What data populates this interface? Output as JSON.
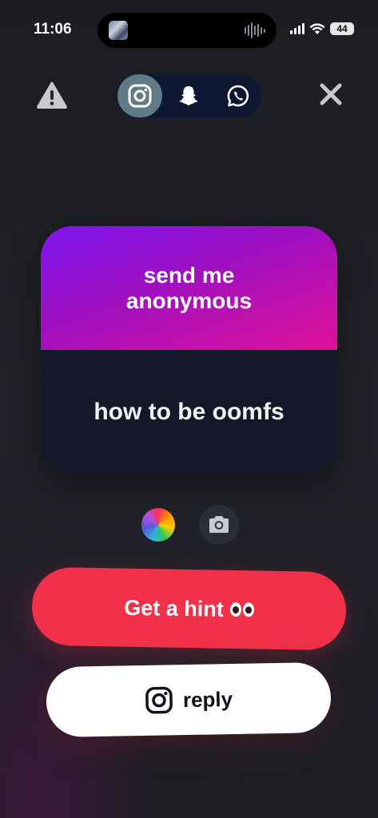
{
  "status_bar": {
    "time": "11:06",
    "battery": "44"
  },
  "top_bar": {
    "share_targets": [
      {
        "name": "instagram",
        "active": true
      },
      {
        "name": "snapchat",
        "active": false
      },
      {
        "name": "whatsapp",
        "active": false
      }
    ]
  },
  "card": {
    "prompt": "send me anonymous",
    "message": "how to be oomfs"
  },
  "actions": {
    "hint_label": "Get a hint",
    "reply_label": "reply"
  },
  "colors": {
    "hint_button": "#f1314a",
    "card_gradient_start": "#7e17f0",
    "card_gradient_end": "#e0129a",
    "card_body": "#141828"
  }
}
